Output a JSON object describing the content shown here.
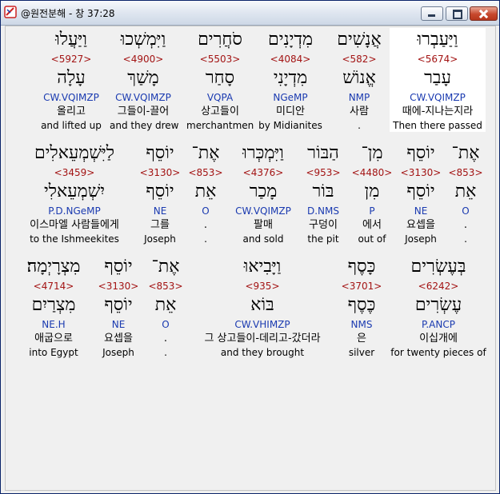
{
  "window": {
    "title": "@원전분해 - 창 37:28",
    "controls": {
      "minimize": "",
      "maximize": "",
      "close": ""
    }
  },
  "rows": [
    {
      "words": [
        {
          "heb": "וַיַּעַבְרוּ",
          "strong": "<5674>",
          "lemma": "עָבַר",
          "morph": "CW.VQIMZP",
          "kor": "때에-지나는지라",
          "eng": "Then there passed",
          "highlight": true
        },
        {
          "heb": "אֲנָשִׁים",
          "strong": "<582>",
          "lemma": "אֱנוֹשׁ",
          "morph": "NMP",
          "kor": "사람",
          "eng": "."
        },
        {
          "heb": "מִדְיָנִים",
          "strong": "<4084>",
          "lemma": "מִדְיָנִי",
          "morph": "NGeMP",
          "kor": "미디안",
          "eng": "by Midianites"
        },
        {
          "heb": "סֹחֲרִים",
          "strong": "<5503>",
          "lemma": "סָחַר",
          "morph": "VQPA",
          "kor": "상고들이",
          "eng": "merchantmen"
        },
        {
          "heb": "וַיִּמְשְׁכוּ",
          "strong": "<4900>",
          "lemma": "מָשַׁךְ",
          "morph": "CW.VQIMZP",
          "kor": "그들이-끌어",
          "eng": "and they drew"
        },
        {
          "heb": "וַיַּעֲלוּ",
          "strong": "<5927>",
          "lemma": "עָלָה",
          "morph": "CW.VQIMZP",
          "kor": "올리고",
          "eng": "and lifted up"
        }
      ]
    },
    {
      "words": [
        {
          "heb": "אֶת־",
          "strong": "<853>",
          "lemma": "אֵת",
          "morph": "O",
          "kor": ".",
          "eng": "."
        },
        {
          "heb": "יוֹסֵף",
          "strong": "<3130>",
          "lemma": "יוֹסֵף",
          "morph": "NE",
          "kor": "요셉을",
          "eng": "Joseph"
        },
        {
          "heb": "מִן־",
          "strong": "<4480>",
          "lemma": "מִן",
          "morph": "P",
          "kor": "에서",
          "eng": "out of"
        },
        {
          "heb": "הַבּוֹר",
          "strong": "<953>",
          "lemma": "בּוֹר",
          "morph": "D.NMS",
          "kor": "구덩이",
          "eng": "the pit"
        },
        {
          "heb": "וַיִּמְכְּרוּ",
          "strong": "<4376>",
          "lemma": "מָכַר",
          "morph": "CW.VQIMZP",
          "kor": "팔매",
          "eng": "and sold"
        },
        {
          "heb": "אֶת־",
          "strong": "<853>",
          "lemma": "אֵת",
          "morph": "O",
          "kor": ".",
          "eng": "."
        },
        {
          "heb": "יוֹסֵף",
          "strong": "<3130>",
          "lemma": "יוֹסֵף",
          "morph": "NE",
          "kor": "그를",
          "eng": "Joseph"
        },
        {
          "heb": "לַיִּשְׁמְעֵאלִים",
          "strong": "<3459>",
          "lemma": "יִשְׁמְעֵאלִי",
          "morph": "P.D.NGeMP",
          "kor": "이스마엘 사람들에게",
          "eng": "to the Ishmeekites"
        }
      ]
    },
    {
      "words": [
        {
          "heb": "בְּעֶשְׂרִים",
          "strong": "<6242>",
          "lemma": "עֶשְׂרִים",
          "morph": "P.ANCP",
          "kor": "이십개에",
          "eng": "for twenty pieces of"
        },
        {
          "heb": "כָּסֶף",
          "strong": "<3701>",
          "lemma": "כֶּסֶף",
          "morph": "NMS",
          "kor": "은",
          "eng": "silver"
        },
        {
          "heb": "וַיָּבִיאוּ",
          "strong": "<935>",
          "lemma": "בּוֹא",
          "morph": "CW.VHIMZP",
          "kor": "그 상고들이-데리고-갔더라",
          "eng": "and they brought"
        },
        {
          "heb": "אֶת־",
          "strong": "<853>",
          "lemma": "אֵת",
          "morph": "O",
          "kor": ".",
          "eng": "."
        },
        {
          "heb": "יוֹסֵף",
          "strong": "<3130>",
          "lemma": "יוֹסֵף",
          "morph": "NE",
          "kor": "요셉을",
          "eng": "Joseph"
        },
        {
          "heb": "מִצְרָיְמָה׃",
          "strong": "<4714>",
          "lemma": "מִצְרַיִם",
          "morph": "NE.H",
          "kor": "애굽으로",
          "eng": "into Egypt"
        }
      ]
    }
  ]
}
